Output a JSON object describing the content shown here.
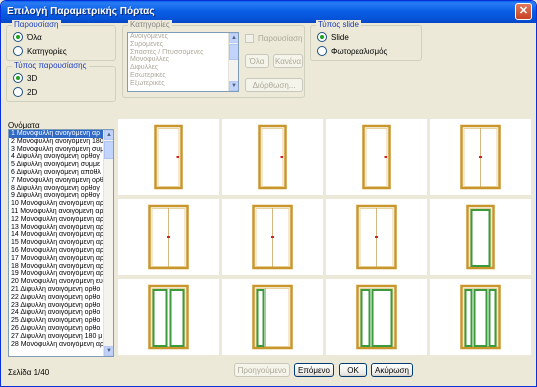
{
  "window": {
    "title": "Επιλογή Παραμετρικής Πόρτας",
    "close_glyph": "✕"
  },
  "display": {
    "legend": "Παρουσίαση",
    "options": [
      "Όλα",
      "Κατηγορίες"
    ],
    "selected": "Όλα"
  },
  "presentation_type": {
    "legend": "Τύπος παρουσίασης",
    "options": [
      "3D",
      "2D"
    ],
    "selected": "3D"
  },
  "categories": {
    "legend": "Κατηγορίες",
    "items": [
      "Ανοιγόμενες",
      "Συρόμενες",
      "Σπαστές / Πτυσσόμενες",
      "Μονόφυλλες",
      "Δίφυλλες",
      "Εσωτερικές",
      "Εξωτερικές"
    ],
    "display_checkbox_label": "Παρουσίαση",
    "all_button": "Όλα",
    "none_button": "Κανένα",
    "edit_button": "Διόρθωση..."
  },
  "slide_type": {
    "legend": "Τύπος slide",
    "options": [
      "Slide",
      "Φωτορεαλισμός"
    ],
    "selected": "Slide"
  },
  "names": {
    "label": "Ονόματα",
    "items": [
      "1 Μονόφυλλη ανοιγόμενη αρ",
      "2 Μονόφυλλη ανοιγόμενη 180",
      "3 Μονόφυλλη ανοιγόμενη συμ",
      "4 Δίφυλλη ανοιγόμενη ορθογ",
      "5 Δίφυλλη ανοιγόμενη συμμε",
      "6 Δίφυλλη ανοιγόμενη απόθλ",
      "7 Μονόφυλλη ανοιγόμενη ορθ",
      "8 Δίφυλλη ανοιγόμενη ορθογ",
      "9 Δίφυλλη ανοιγόμενη ορθογ",
      "10 Μονόφυλλη ανοιγόμενη αρ",
      "11 Μονόφυλλη ανοιγόμενη αρ",
      "12 Μονόφυλλη ανοιγόμενη αρ",
      "13 Μονόφυλλη ανοιγόμενη αρ",
      "14 Μονόφυλλη ανοιγόμενη αρ",
      "15 Μονόφυλλη ανοιγόμενη αρ",
      "16 Μονόφυλλη ανοιγόμενη αρ",
      "17 Μονόφυλλη ανοιγόμενη αρ",
      "18 Μονόφυλλη ανοιγόμενη αρ",
      "19 Μονόφυλλη ανοιγόμενη αρ",
      "20 Μονόφυλλη ανοιγόμενη ευ",
      "21 Δίφυλλη ανοιγόμενη ορθο",
      "22 Δίφυλλη ανοιγόμενη ορθο",
      "23 Δίφυλλη ανοιγόμενη ορθο",
      "24 Δίφυλλη ανοιγόμενη ορθο",
      "25 Δίφυλλη ανοιγόμενη ορθο",
      "26 Δίφυλλη ανοιγόμενη ορθο",
      "27 Δίφυλλη ανοιγόμενη 180 μ",
      "28 Μονόφυλλη ανοιγόμενη αρ"
    ],
    "selected_index": 0
  },
  "thumbnails": [
    {
      "style": "single-handle"
    },
    {
      "style": "single-handle"
    },
    {
      "style": "single-handle"
    },
    {
      "style": "double-handle"
    },
    {
      "style": "double-handle"
    },
    {
      "style": "double-handle"
    },
    {
      "style": "double-handle"
    },
    {
      "style": "single-green-panel"
    },
    {
      "style": "double-green-panel"
    },
    {
      "style": "single-green-sidelight"
    },
    {
      "style": "double-green-narrow"
    },
    {
      "style": "double-green-sidelights"
    }
  ],
  "colors": {
    "frame": "#c8962a",
    "handle": "#d32020",
    "panel": "#3b9a3b"
  },
  "footer": {
    "page_label": "Σελίδα 1/40",
    "previous_button": "Προηγούμενο",
    "next_button": "Επόμενο",
    "ok_button": "ΟΚ",
    "cancel_button": "Ακύρωση"
  }
}
